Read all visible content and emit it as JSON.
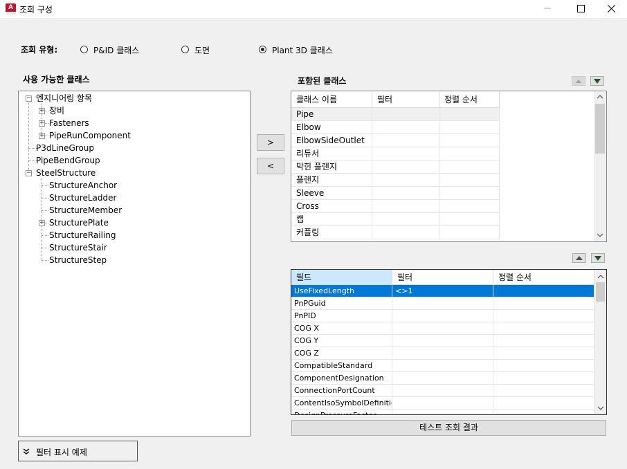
{
  "window": {
    "title": "조회 구성",
    "app_icon_letter": "A"
  },
  "query_type": {
    "label": "조회 유형:",
    "options": [
      {
        "label": "P&ID 클래스",
        "selected": false
      },
      {
        "label": "도면",
        "selected": false
      },
      {
        "label": "Plant 3D 클래스",
        "selected": true
      }
    ]
  },
  "available": {
    "title": "사용 가능한 클래스",
    "tree": [
      {
        "label": "엔지니어링 항목",
        "expander": "minus"
      },
      {
        "label": "장비",
        "expander": "plus"
      },
      {
        "label": "Fasteners",
        "expander": "plus"
      },
      {
        "label": "PipeRunComponent",
        "expander": "plus"
      },
      {
        "label": "P3dLineGroup",
        "expander": "none"
      },
      {
        "label": "PipeBendGroup",
        "expander": "none"
      },
      {
        "label": "SteelStructure",
        "expander": "minus"
      },
      {
        "label": "StructureAnchor",
        "expander": "none"
      },
      {
        "label": "StructureLadder",
        "expander": "none"
      },
      {
        "label": "StructureMember",
        "expander": "none"
      },
      {
        "label": "StructurePlate",
        "expander": "plus"
      },
      {
        "label": "StructureRailing",
        "expander": "none"
      },
      {
        "label": "StructureStair",
        "expander": "none"
      },
      {
        "label": "StructureStep",
        "expander": "none"
      }
    ]
  },
  "move_buttons": {
    "add": ">",
    "remove": "<"
  },
  "included": {
    "title": "포함된 클래스",
    "columns": [
      "클래스 이름",
      "필터",
      "정렬 순서"
    ],
    "rows": [
      "Pipe",
      "Elbow",
      "ElbowSideOutlet",
      "리듀서",
      "막힌 플랜지",
      "플랜지",
      "Sleeve",
      "Cross",
      "캡",
      "커플링"
    ]
  },
  "fields": {
    "columns": [
      "필드",
      "필터",
      "정렬 순서"
    ],
    "rows": [
      {
        "field": "UseFixedLength",
        "filter": "<>1",
        "order": ""
      },
      {
        "field": "PnPGuid",
        "filter": "",
        "order": ""
      },
      {
        "field": "PnPID",
        "filter": "",
        "order": ""
      },
      {
        "field": "COG X",
        "filter": "",
        "order": ""
      },
      {
        "field": "COG Y",
        "filter": "",
        "order": ""
      },
      {
        "field": "COG Z",
        "filter": "",
        "order": ""
      },
      {
        "field": "CompatibleStandard",
        "filter": "",
        "order": ""
      },
      {
        "field": "ComponentDesignation",
        "filter": "",
        "order": ""
      },
      {
        "field": "ConnectionPortCount",
        "filter": "",
        "order": ""
      },
      {
        "field": "ContentIsoSymbolDefinition",
        "filter": "",
        "order": ""
      },
      {
        "field": "DesignPressureFactor",
        "filter": "",
        "order": ""
      }
    ]
  },
  "test_button": "테스트 조회 결과",
  "filter_toggle": "필터 표시 예제",
  "colors": {
    "selection": "#0078d7",
    "header_selected": "#cce8ff",
    "arrow_green": "#1e5a1e"
  }
}
